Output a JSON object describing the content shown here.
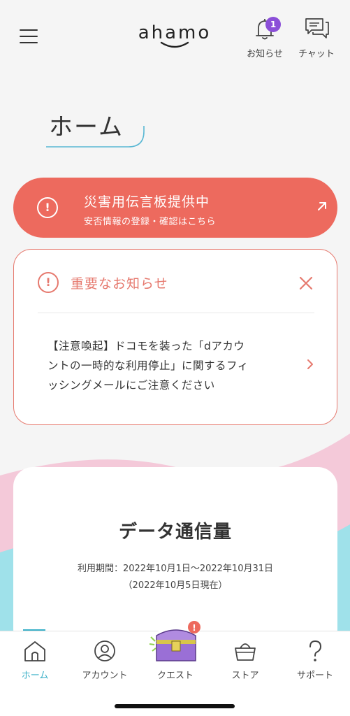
{
  "header": {
    "brand": "ahamo",
    "notifications": {
      "label": "お知らせ",
      "badge_count": "1",
      "icon": "bell-icon"
    },
    "chat": {
      "label": "チャット",
      "icon": "chat-bubbles-icon"
    },
    "menu_icon": "hamburger-icon"
  },
  "page": {
    "title": "ホーム"
  },
  "disaster_banner": {
    "title": "災害用伝言板提供中",
    "subtitle": "安否情報の登録・確認はこちら",
    "icon": "alert-icon",
    "color": "#ed6a5e"
  },
  "notice": {
    "title": "重要なお知らせ",
    "message_lines": [
      "【注意喚起】ドコモを装った「dアカウ",
      "ントの一時的な利用停止」に関するフィ",
      "ッシングメールにご注意ください"
    ],
    "accent": "#e6796e"
  },
  "data_usage": {
    "title": "データ通信量",
    "period": "利用期間：2022年10月1日〜2022年10月31日",
    "as_of": "（2022年10月5日現在）"
  },
  "bottom_nav": {
    "items": [
      {
        "label": "ホーム",
        "icon": "home-icon",
        "active": true
      },
      {
        "label": "アカウント",
        "icon": "account-icon",
        "active": false
      },
      {
        "label": "クエスト",
        "icon": "treasure-chest-icon",
        "active": false
      },
      {
        "label": "ストア",
        "icon": "shopping-basket-icon",
        "active": false
      },
      {
        "label": "サポート",
        "icon": "question-icon",
        "active": false
      }
    ],
    "active_color": "#3ab0c8"
  }
}
